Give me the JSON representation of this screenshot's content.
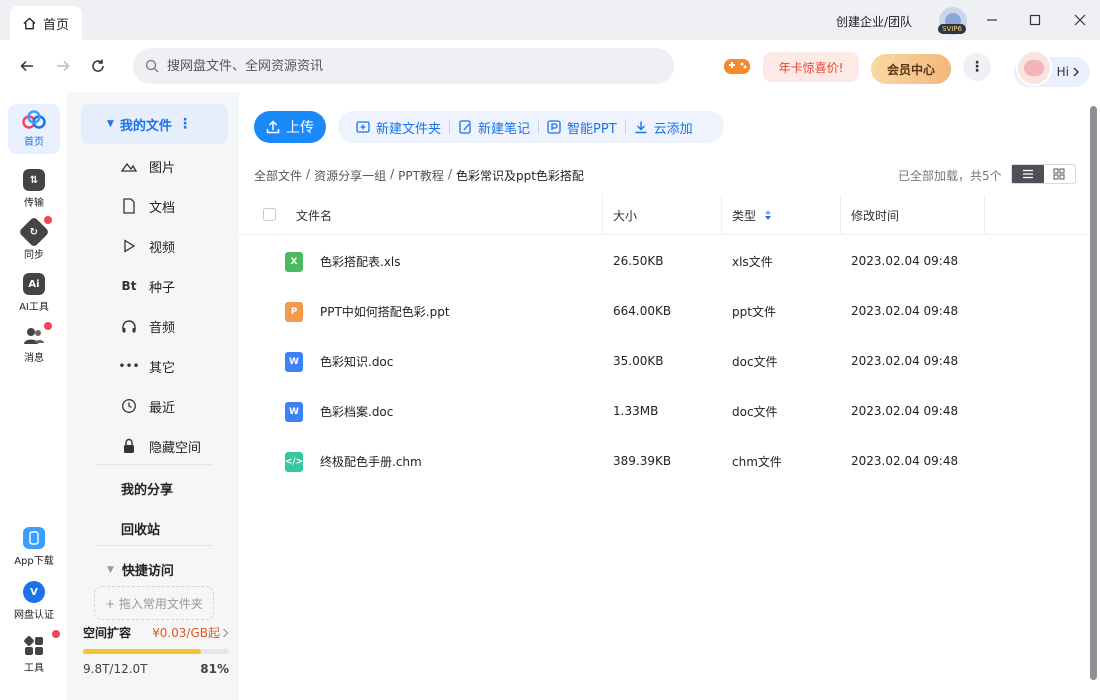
{
  "window": {
    "tab_label": "首页",
    "create_org": "创建企业/团队",
    "svip_badge": "SVIP6"
  },
  "nav": {
    "search_placeholder": "搜网盘文件、全网资源资讯",
    "promo_label": "年卡惊喜价!",
    "vip_label": "会员中心",
    "hi_label": "Hi"
  },
  "rail": {
    "items": [
      {
        "label": "首页",
        "icon": "cloud-home-icon"
      },
      {
        "label": "传输",
        "icon": "transfer-icon"
      },
      {
        "label": "同步",
        "icon": "sync-icon"
      },
      {
        "label": "AI工具",
        "icon": "ai-icon"
      },
      {
        "label": "消息",
        "icon": "message-icon"
      }
    ],
    "bottom": [
      {
        "label": "App下载",
        "icon": "phone-icon"
      },
      {
        "label": "网盘认证",
        "icon": "verify-icon"
      },
      {
        "label": "工具",
        "icon": "tools-icon"
      }
    ],
    "ai_icon_text": "Ai"
  },
  "sidebar": {
    "my_files": "我的文件",
    "items": [
      {
        "label": "图片",
        "icon": "image-icon"
      },
      {
        "label": "文档",
        "icon": "document-icon"
      },
      {
        "label": "视频",
        "icon": "video-icon"
      },
      {
        "label": "种子",
        "icon": "torrent-icon"
      },
      {
        "label": "音频",
        "icon": "headphones-icon"
      },
      {
        "label": "其它",
        "icon": "more-dots-icon"
      },
      {
        "label": "最近",
        "icon": "history-icon"
      },
      {
        "label": "隐藏空间",
        "icon": "lock-icon"
      }
    ],
    "torrent_text": "Bt",
    "my_share": "我的分享",
    "recycle": "回收站",
    "quick_access": "快捷访问",
    "drop_hint": "+ 拖入常用文件夹",
    "space_title": "空间扩容",
    "space_price": "¥0.03/GB起",
    "space_used": "9.8T/12.0T",
    "space_percent": "81%",
    "space_fraction": 0.81
  },
  "toolbar": {
    "upload": "上传",
    "new_folder": "新建文件夹",
    "new_note": "新建笔记",
    "smart_ppt": "智能PPT",
    "cloud_add": "云添加"
  },
  "breadcrumb": [
    "全部文件",
    "资源分享一组",
    "PPT教程",
    "色彩常识及ppt色彩搭配"
  ],
  "breadcrumb_sep": "/",
  "loaded_text": "已全部加载，共5个",
  "table": {
    "headers": {
      "name": "文件名",
      "size": "大小",
      "type": "类型",
      "modified": "修改时间"
    },
    "rows": [
      {
        "name": "色彩搭配表.xls",
        "size": "26.50KB",
        "type": "xls文件",
        "modified": "2023.02.04 09:48",
        "icon": "excel-file-icon",
        "color": "#4cbb5f",
        "glyph": "X"
      },
      {
        "name": "PPT中如何搭配色彩.ppt",
        "size": "664.00KB",
        "type": "ppt文件",
        "modified": "2023.02.04 09:48",
        "icon": "ppt-file-icon",
        "color": "#f59a4b",
        "glyph": "P"
      },
      {
        "name": "色彩知识.doc",
        "size": "35.00KB",
        "type": "doc文件",
        "modified": "2023.02.04 09:48",
        "icon": "word-file-icon",
        "color": "#3c82f6",
        "glyph": "W"
      },
      {
        "name": "色彩档案.doc",
        "size": "1.33MB",
        "type": "doc文件",
        "modified": "2023.02.04 09:48",
        "icon": "word-file-icon",
        "color": "#3c82f6",
        "glyph": "W"
      },
      {
        "name": "终极配色手册.chm",
        "size": "389.39KB",
        "type": "chm文件",
        "modified": "2023.02.04 09:48",
        "icon": "chm-file-icon",
        "color": "#36c6a0",
        "glyph": "</>"
      }
    ]
  },
  "colors": {
    "accent": "#1a73e8",
    "upload": "#1a8af8",
    "badge_red": "#f2465b",
    "space_bar": "#f6c22d"
  }
}
